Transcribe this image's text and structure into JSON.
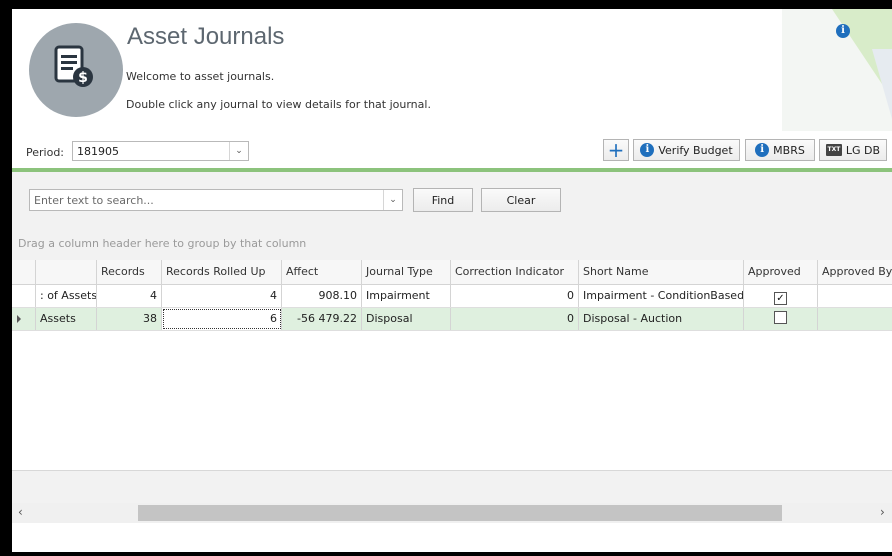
{
  "header": {
    "title": "Asset Journals",
    "welcome": "Welcome to asset journals.",
    "instruction": "Double click any journal to view details for that journal."
  },
  "period": {
    "label": "Period:",
    "value": "181905"
  },
  "toolbar": {
    "add_icon": "plus-icon",
    "verify_budget_label": "Verify Budget",
    "mbrs_label": "MBRS",
    "lgdb_label": "LG DB"
  },
  "search": {
    "placeholder": "Enter text to search...",
    "find_label": "Find",
    "clear_label": "Clear"
  },
  "group_hint": "Drag a column header here to group by that column",
  "grid": {
    "columns": [
      "",
      "Records",
      "Records Rolled Up",
      "Affect",
      "Journal Type",
      "Correction Indicator",
      "Short Name",
      "Approved",
      "Approved By"
    ],
    "rows": [
      {
        "name": ": of Assets",
        "records": "4",
        "rolled_up": "4",
        "affect": "908.10",
        "journal_type": "Impairment",
        "correction": "0",
        "short_name": "Impairment - ConditionBased",
        "approved": "✓"
      },
      {
        "name": "Assets",
        "records": "38",
        "rolled_up": "6",
        "affect": "-56 479.22",
        "journal_type": "Disposal",
        "correction": "0",
        "short_name": "Disposal - Auction",
        "approved": ""
      }
    ]
  },
  "colors": {
    "accent_green": "#8cc37c",
    "selected_row": "#dff0df",
    "info_blue": "#1f6fbd"
  }
}
